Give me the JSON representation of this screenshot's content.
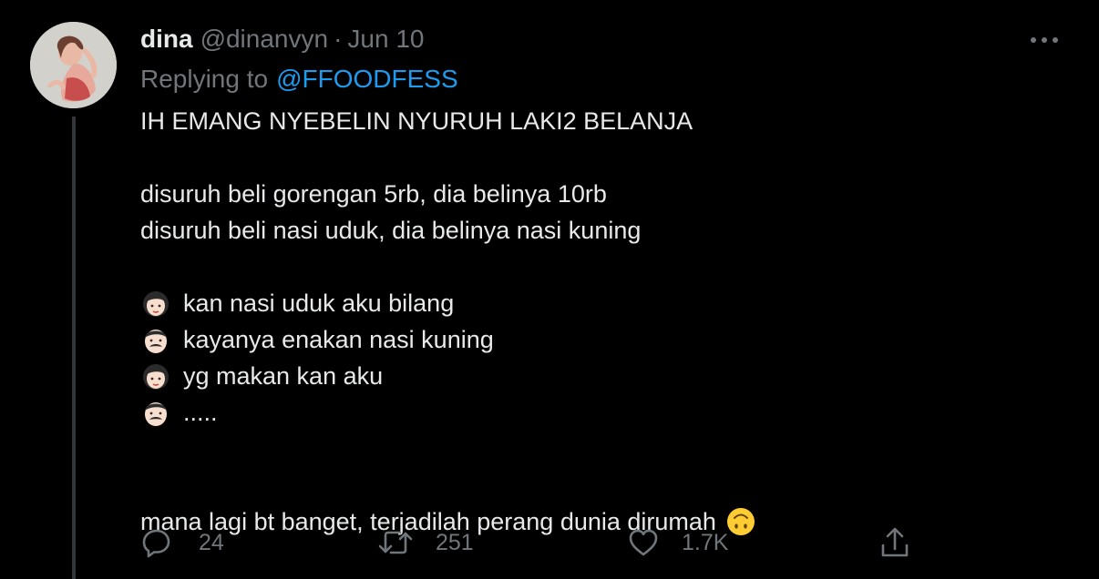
{
  "author": {
    "display_name": "dina",
    "handle": "@dinanvyn",
    "separator": "·",
    "date": "Jun 10"
  },
  "reply": {
    "prefix": "Replying to",
    "mention": "@FFOODFESS"
  },
  "body": {
    "line1": "IH EMANG NYEBELIN NYURUH LAKI2 BELANJA",
    "line2": "disuruh beli gorengan 5rb, dia belinya 10rb",
    "line3": "disuruh beli nasi uduk, dia belinya nasi kuning",
    "dialogue": [
      {
        "speaker_icon": "woman-emoji-icon",
        "text": "kan nasi uduk aku bilang"
      },
      {
        "speaker_icon": "man-emoji-icon",
        "text": "kayanya enakan nasi kuning"
      },
      {
        "speaker_icon": "woman-emoji-icon",
        "text": "yg makan kan aku"
      },
      {
        "speaker_icon": "man-emoji-icon",
        "text": "....."
      }
    ],
    "closing": "mana lagi bt banget, terjadilah perang dunia dirumah",
    "closing_icon": "upside-down-face-emoji-icon"
  },
  "actions": {
    "replies": "24",
    "retweets": "251",
    "likes": "1.7K"
  },
  "icons": {
    "more": "more-dots-icon",
    "reply": "reply-bubble-icon",
    "retweet": "retweet-icon",
    "like": "heart-icon",
    "share": "share-icon"
  },
  "colors": {
    "background": "#000000",
    "text_primary": "#e7e9ea",
    "text_secondary": "#71767b",
    "accent": "#1d9bf0",
    "thread_line": "#333639"
  }
}
